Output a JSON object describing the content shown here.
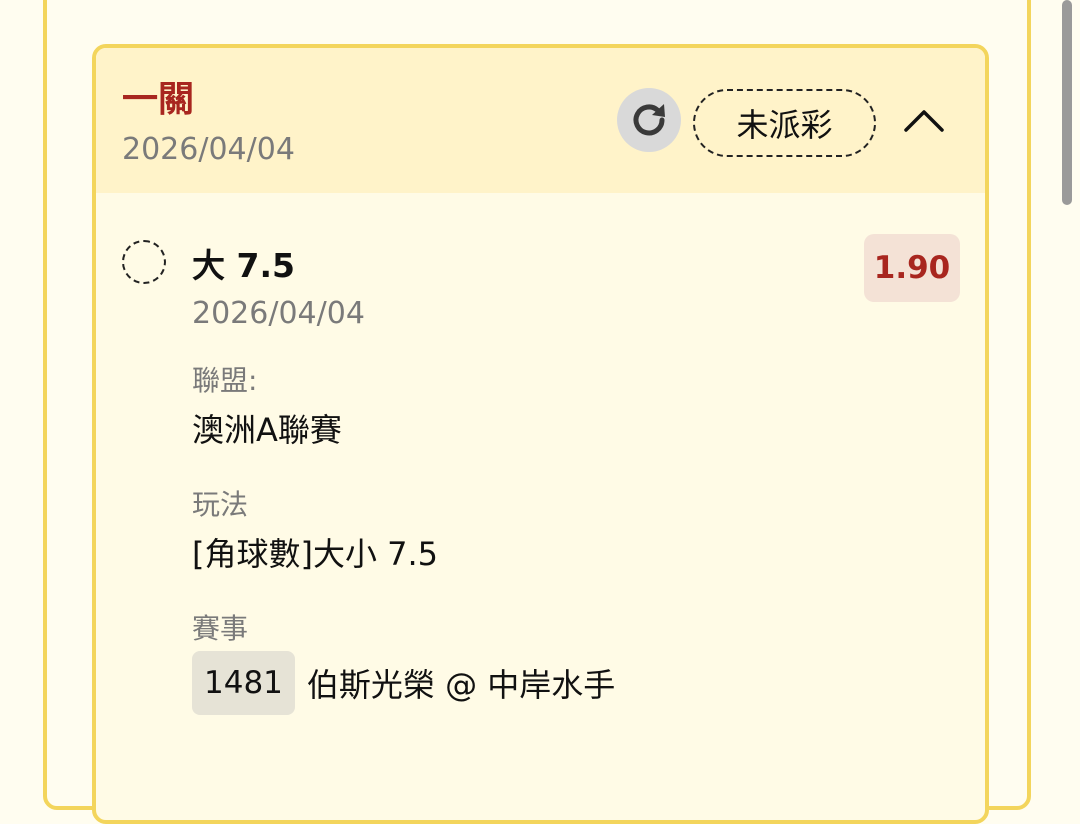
{
  "header": {
    "bet_type": "一關",
    "date": "2026/04/04",
    "status": "未派彩"
  },
  "selection": {
    "name": "大 7.5",
    "date": "2026/04/04",
    "odds": "1.90"
  },
  "details": {
    "league_label": "聯盟:",
    "league_value": "澳洲A聯賽",
    "market_label": "玩法",
    "market_value": "[角球數]大小 7.5",
    "match_label": "賽事",
    "match_code": "1481",
    "match_teams": "伯斯光榮 @ 中岸水手"
  },
  "icons": {
    "refresh": "refresh-icon",
    "collapse": "chevron-up-icon",
    "selection": "dashed-radio-icon"
  },
  "colors": {
    "accent_red": "#a8261f",
    "border_yellow": "#f3d55c",
    "header_bg": "#fff3c9"
  }
}
